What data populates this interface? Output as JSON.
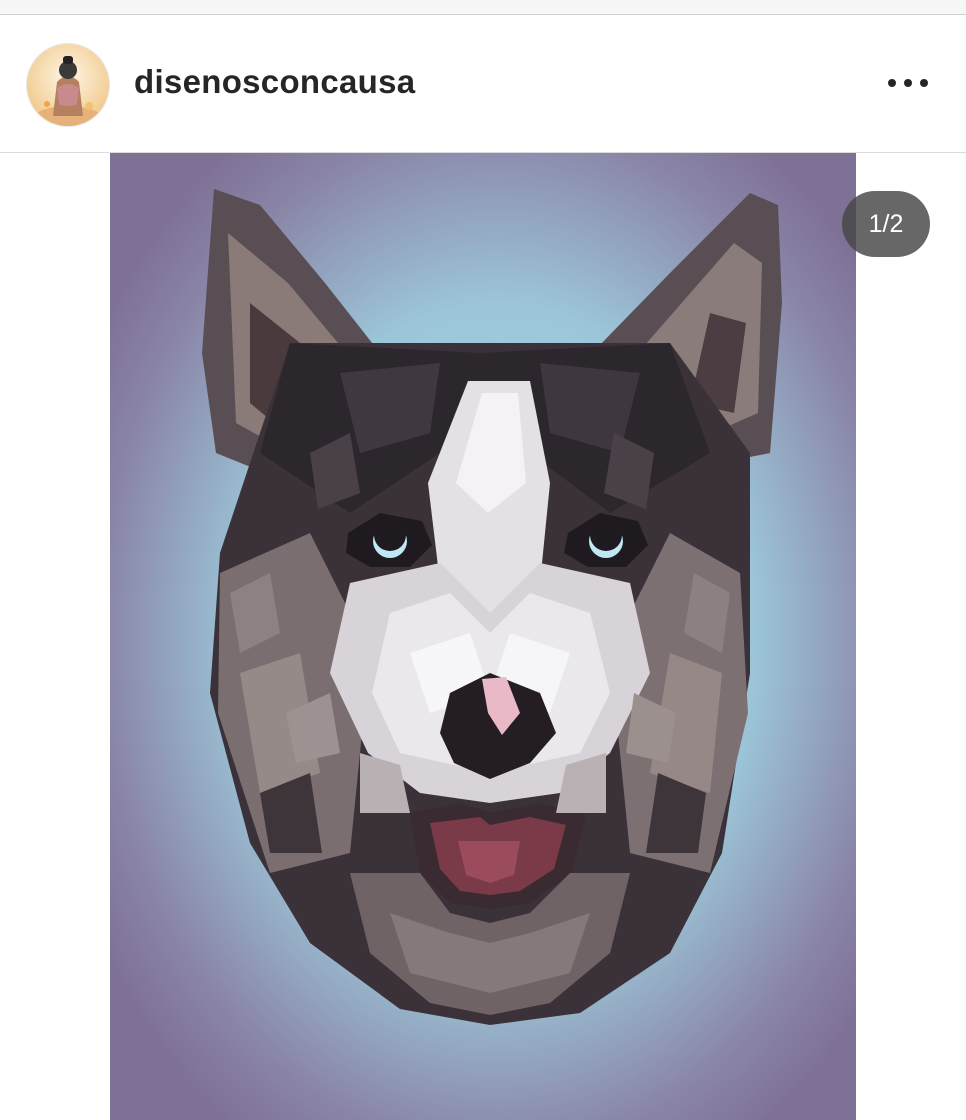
{
  "post": {
    "username": "disenosconcausa",
    "more_icon": "more-horizontal-icon",
    "avatar_icon": "profile-avatar",
    "carousel_counter": "1/2"
  },
  "colors": {
    "background_purple": "#7f7196",
    "glow_blue": "#9fd4e2",
    "fur_dark": "#2b2630",
    "fur_mid": "#7d7174",
    "fur_light": "#e9e7ea",
    "eye_blue": "#bfe8f4",
    "nose_pink": "#e8b8c6",
    "mouth": "#7a3a48"
  }
}
